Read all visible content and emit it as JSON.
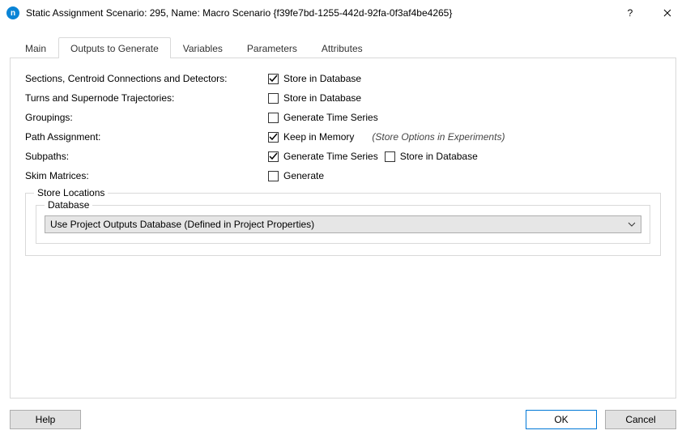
{
  "window": {
    "title": "Static Assignment Scenario: 295, Name: Macro Scenario  {f39fe7bd-1255-442d-92fa-0f3af4be4265}",
    "help_glyph": "?",
    "close_glyph": "✕"
  },
  "tabs": {
    "items": [
      {
        "label": "Main"
      },
      {
        "label": "Outputs to Generate"
      },
      {
        "label": "Variables"
      },
      {
        "label": "Parameters"
      },
      {
        "label": "Attributes"
      }
    ],
    "active_index": 1
  },
  "outputs": {
    "rows": [
      {
        "label": "Sections, Centroid Connections and Detectors:",
        "controls": [
          {
            "type": "checkbox",
            "checked": true,
            "label": "Store in Database"
          }
        ]
      },
      {
        "label": "Turns and Supernode Trajectories:",
        "controls": [
          {
            "type": "checkbox",
            "checked": false,
            "label": "Store in Database"
          }
        ]
      },
      {
        "label": "Groupings:",
        "controls": [
          {
            "type": "checkbox",
            "checked": false,
            "label": "Generate Time Series"
          }
        ]
      },
      {
        "label": "Path Assignment:",
        "controls": [
          {
            "type": "checkbox",
            "checked": true,
            "label": "Keep in Memory"
          },
          {
            "type": "note",
            "text": "(Store Options in Experiments)"
          }
        ]
      },
      {
        "label": "Subpaths:",
        "controls": [
          {
            "type": "checkbox",
            "checked": true,
            "label": "Generate Time Series"
          },
          {
            "type": "checkbox",
            "checked": false,
            "label": "Store in Database"
          }
        ]
      },
      {
        "label": "Skim Matrices:",
        "controls": [
          {
            "type": "checkbox",
            "checked": false,
            "label": "Generate"
          }
        ]
      }
    ],
    "store_locations": {
      "legend": "Store Locations",
      "database": {
        "legend": "Database",
        "selected": "Use Project Outputs Database (Defined in Project Properties)"
      }
    }
  },
  "footer": {
    "help": "Help",
    "ok": "OK",
    "cancel": "Cancel"
  }
}
